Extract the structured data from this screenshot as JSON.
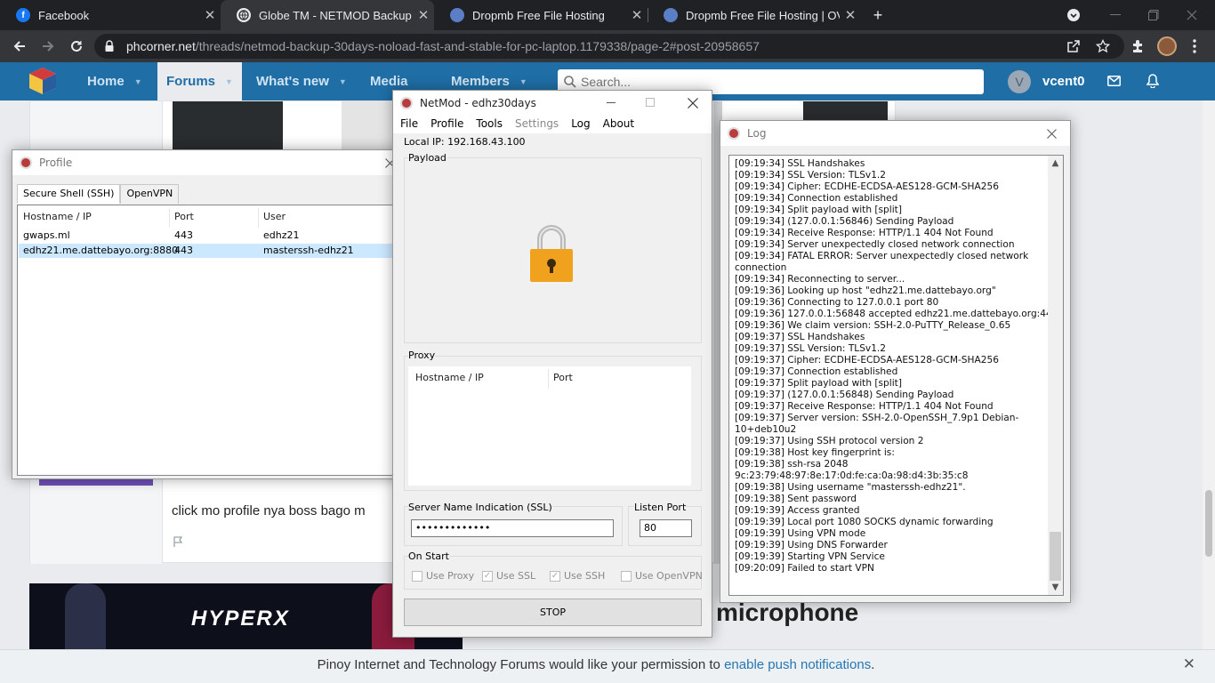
{
  "browser": {
    "tabs": [
      {
        "title": "Facebook",
        "icon": "facebook-icon",
        "active": false
      },
      {
        "title": "Globe TM - NETMOD Backup 30D",
        "icon": "globe-icon",
        "active": true
      },
      {
        "title": "Dropmb Free File Hosting",
        "icon": "dropmb-icon",
        "active": false
      },
      {
        "title": "Dropmb Free File Hosting | OVPN",
        "icon": "dropmb-icon",
        "active": false
      }
    ],
    "tab_close": "✕",
    "new_tab": "+",
    "url_host": "phcorner.net",
    "url_path": "/threads/netmod-backup-30days-noload-fast-and-stable-for-pc-laptop.1179338/page-2#post-20958657"
  },
  "site": {
    "nav": [
      {
        "label": "Home"
      },
      {
        "label": "Forums"
      },
      {
        "label": "What's new"
      },
      {
        "label": "Media"
      },
      {
        "label": "Members"
      }
    ],
    "search_placeholder": "Search...",
    "avatar_letter": "V",
    "username": "vcent0",
    "accent": "#1f6ea6"
  },
  "post": {
    "text": "click mo profile nya boss bago m",
    "ad_brand": "HYPERX",
    "ad_word": "microphone"
  },
  "notification": {
    "text": "Pinoy Internet and Technology Forums would like your permission to ",
    "link": "enable push notifications",
    "end": ".",
    "close": "✕"
  },
  "profile_window": {
    "title": "Profile",
    "tabs": [
      "Secure Shell (SSH)",
      "OpenVPN"
    ],
    "columns": [
      "Hostname / IP",
      "Port",
      "User"
    ],
    "rows": [
      {
        "host": "gwaps.ml",
        "port": "443",
        "user": "edhz21",
        "selected": false
      },
      {
        "host": "edhz21.me.dattebayo.org:8880",
        "port": "443",
        "user": "masterssh-edhz21",
        "selected": true
      }
    ]
  },
  "netmod_window": {
    "title": "NetMod - edhz30days",
    "menu": [
      "File",
      "Profile",
      "Tools",
      "Settings",
      "Log",
      "About"
    ],
    "local_ip": "Local IP: 192.168.43.100",
    "payload_label": "Payload",
    "lock_icon": "padlock-icon",
    "proxy_label": "Proxy",
    "proxy_columns": [
      "Hostname / IP",
      "Port"
    ],
    "sni_label": "Server Name Indication (SSL)",
    "sni_value": "•••••••••••••",
    "listen_port_label": "Listen Port",
    "listen_port_value": "80",
    "on_start_label": "On Start",
    "checkboxes": [
      {
        "label": "Use Proxy",
        "checked": false
      },
      {
        "label": "Use SSL",
        "checked": true
      },
      {
        "label": "Use SSH",
        "checked": true
      },
      {
        "label": "Use OpenVPN",
        "checked": false
      }
    ],
    "stop_button": "STOP"
  },
  "log_window": {
    "title": "Log",
    "lines": [
      "[09:19:34] SSL Handshakes",
      "[09:19:34] SSL Version: TLSv1.2",
      "[09:19:34] Cipher: ECDHE-ECDSA-AES128-GCM-SHA256",
      "[09:19:34] Connection established",
      "[09:19:34] Split payload with [split]",
      "[09:19:34] (127.0.0.1:56846) Sending Payload",
      "[09:19:34] Receive Response: HTTP/1.1 404 Not Found",
      "[09:19:34] Server unexpectedly closed network connection",
      "[09:19:34] FATAL ERROR: Server unexpectedly closed network",
      "connection",
      "[09:19:34] Reconnecting to server...",
      "[09:19:36] Looking up host \"edhz21.me.dattebayo.org\"",
      "[09:19:36] Connecting to 127.0.0.1 port 80",
      "[09:19:36] 127.0.0.1:56848 accepted edhz21.me.dattebayo.org:443",
      "[09:19:36] We claim version: SSH-2.0-PuTTY_Release_0.65",
      "[09:19:37] SSL Handshakes",
      "[09:19:37] SSL Version: TLSv1.2",
      "[09:19:37] Cipher: ECDHE-ECDSA-AES128-GCM-SHA256",
      "[09:19:37] Connection established",
      "[09:19:37] Split payload with [split]",
      "[09:19:37] (127.0.0.1:56848) Sending Payload",
      "[09:19:37] Receive Response: HTTP/1.1 404 Not Found",
      "[09:19:37] Server version: SSH-2.0-OpenSSH_7.9p1 Debian-",
      "10+deb10u2",
      "[09:19:37] Using SSH protocol version 2",
      "[09:19:38] Host key fingerprint is:",
      "[09:19:38] ssh-rsa 2048",
      "9c:23:79:48:97:8e:17:0d:fe:ca:0a:98:d4:3b:35:c8",
      "[09:19:38] Using username \"masterssh-edhz21\".",
      "[09:19:38] Sent password",
      "[09:19:39] Access granted",
      "[09:19:39] Local port 1080 SOCKS dynamic forwarding",
      "[09:19:39] Using VPN mode",
      "[09:19:39] Using DNS Forwarder",
      "[09:19:39] Starting VPN Service",
      "[09:20:09] Failed to start VPN"
    ]
  }
}
